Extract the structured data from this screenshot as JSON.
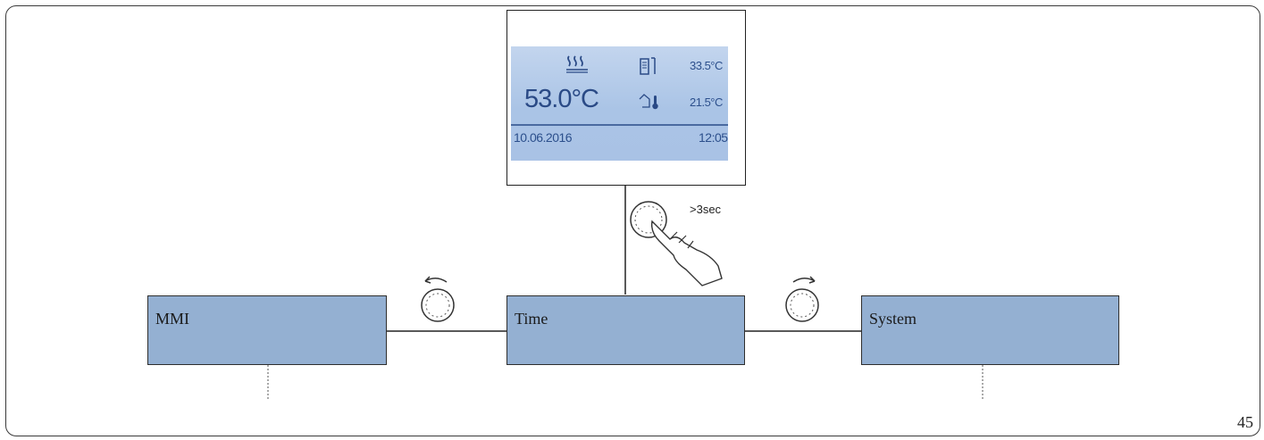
{
  "display": {
    "mode_icon": "heating-icon",
    "flow_temp": "53.0°C",
    "cylinder_icon": "hot-water-cylinder-icon",
    "cylinder_temp": "33.5°C",
    "outdoor_icon": "outdoor-temperature-icon",
    "outdoor_temp": "21.5°C",
    "date": "10.06.2016",
    "time": "12:05"
  },
  "actions": {
    "press_hint": ">3sec",
    "press_icon": "hand-press-knob-icon",
    "rotate_left_icon": "rotate-counterclockwise-icon",
    "rotate_right_icon": "rotate-clockwise-icon"
  },
  "menu": {
    "left": "MMI",
    "center": "Time",
    "right": "System"
  },
  "page_number": "45",
  "colors": {
    "menu_box": "#94b0d2",
    "lcd_background": "#aac4e6",
    "lcd_text": "#2c4f8c",
    "frame": "#3a3a3a"
  }
}
